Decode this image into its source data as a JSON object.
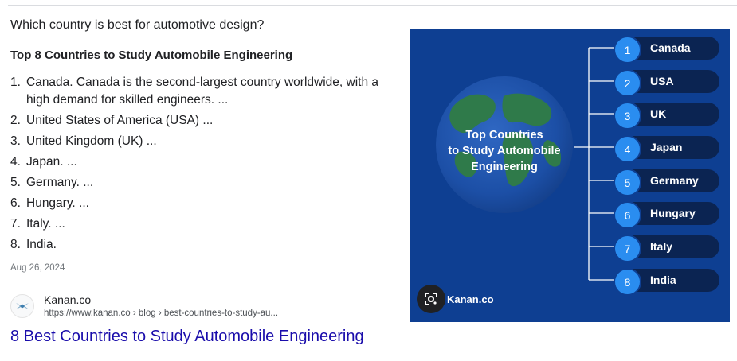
{
  "question": "Which country is best for automotive design?",
  "answer": {
    "title": "Top 8 Countries to Study Automobile Engineering",
    "items": [
      {
        "num": "1.",
        "text": "Canada. Canada is the second-largest country worldwide, with a high demand for skilled engineers. ..."
      },
      {
        "num": "2.",
        "text": "United States of America (USA) ..."
      },
      {
        "num": "3.",
        "text": "United Kingdom (UK) ..."
      },
      {
        "num": "4.",
        "text": "Japan. ..."
      },
      {
        "num": "5.",
        "text": "Germany. ..."
      },
      {
        "num": "6.",
        "text": "Hungary. ..."
      },
      {
        "num": "7.",
        "text": "Italy. ..."
      },
      {
        "num": "8.",
        "text": "India."
      }
    ],
    "date": "Aug 26, 2024"
  },
  "source": {
    "site_name": "Kanan.co",
    "url": "https://www.kanan.co › blog › best-countries-to-study-au...",
    "result_title": "8 Best Countries to Study Automobile Engineering"
  },
  "image": {
    "globe_title": [
      "Top Countries",
      "to Study Automobile",
      "Engineering"
    ],
    "countries": [
      {
        "num": "1",
        "name": "Canada"
      },
      {
        "num": "2",
        "name": "USA"
      },
      {
        "num": "3",
        "name": "UK"
      },
      {
        "num": "4",
        "name": "Japan"
      },
      {
        "num": "5",
        "name": "Germany"
      },
      {
        "num": "6",
        "name": "Hungary"
      },
      {
        "num": "7",
        "name": "Italy"
      },
      {
        "num": "8",
        "name": "India"
      }
    ],
    "brand": "Kanan.co"
  },
  "icons": {
    "favicon": "kanan-logo-icon",
    "lens": "google-lens-icon"
  },
  "colors": {
    "link": "#1a0dab",
    "image_background": "#0e3f92",
    "pill": "#0b2452",
    "badge": "#2a8df0"
  }
}
